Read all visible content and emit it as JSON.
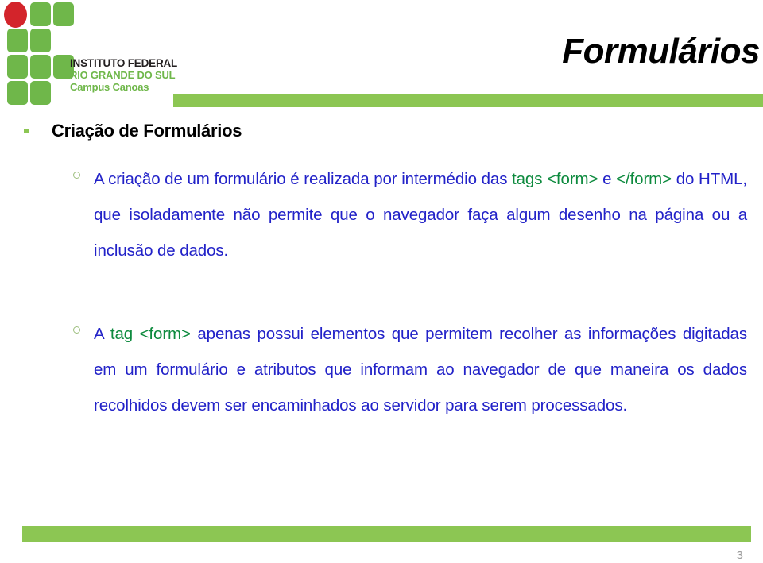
{
  "slide": {
    "title": "Formulários",
    "page_number": "3",
    "accent_green": "#8cc653",
    "logo_green": "#6fb74a",
    "logo_red": "#d3242b",
    "body_blue": "#2222c8",
    "code_green": "#0d8a3e"
  },
  "logo": {
    "line_1": "INSTITUTO FEDERAL",
    "line_2": "RIO GRANDE DO SUL",
    "line_3": "Campus Canoas"
  },
  "content": {
    "heading": "Criação de Formulários",
    "paragraph_1": {
      "segments": [
        {
          "text": "A criação de um formulário é realizada por intermédio das ",
          "style": "plain"
        },
        {
          "text": "tags <form> e </form>",
          "style": "code"
        },
        {
          "text": "  do HTML, que isoladamente não permite que o navegador faça algum desenho na página ou a inclusão de  dados.",
          "style": "plain"
        }
      ],
      "s0": "A criação de um formulário é realizada por intermédio das ",
      "s1": "tags ",
      "s2": "<form>",
      "s3": " e ",
      "s4": "</form>",
      "s5": "  do HTML, que isoladamente não permite que o navegador faça algum desenho na página ou a inclusão de  dados."
    },
    "paragraph_2": {
      "s0": "A ",
      "s1": "tag <form>",
      "s2": " apenas possui elementos que permitem recolher as informações digitadas em um formulário e atributos que informam ao navegador de que maneira os dados recolhidos devem ser encaminhados ao servidor para serem processados."
    }
  }
}
